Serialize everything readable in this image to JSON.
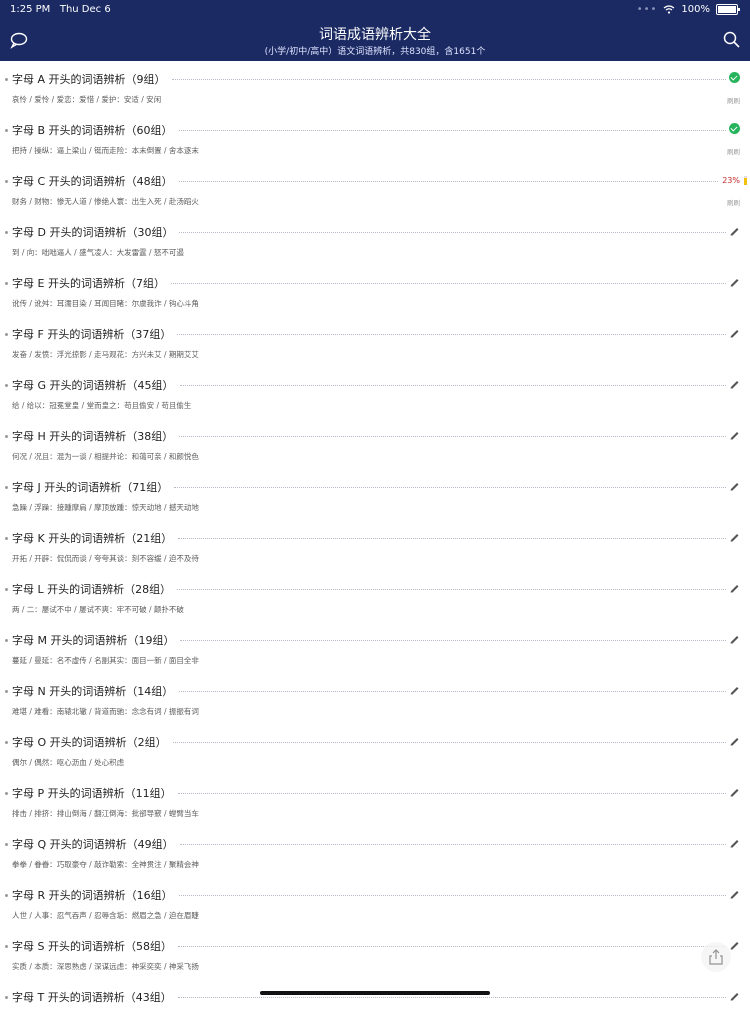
{
  "status": {
    "time": "1:25 PM",
    "date": "Thu Dec 6",
    "battery": "100%"
  },
  "header": {
    "title": "词语成语辨析大全",
    "subtitle": "(小学/初中/高中）语文词语辨析，共830组，含1651个"
  },
  "icons": {
    "chat": "chat-bubble-icon",
    "search": "search-icon",
    "share": "share-icon",
    "edit": "pencil-icon",
    "done": "checkmark-circle-icon"
  },
  "colors": {
    "header_bg": "#1b2a63",
    "done_green": "#25b35b",
    "percent_red": "#c62828",
    "progress_yellow": "#f4c20d"
  },
  "groups": [
    {
      "heading": "字母 A 开头的词语辨析（9组）",
      "sub": "哀怜 / 爱怜 / 爱恋：爱惜 / 爱护：安适 / 安闲",
      "state": "done",
      "tag": "刷刷"
    },
    {
      "heading": "字母 B 开头的词语辨析（60组）",
      "sub": "把持 / 操纵：逼上梁山 / 铤而走险：本末倒置 / 舍本逐末",
      "state": "done",
      "tag": "刷刷"
    },
    {
      "heading": "字母 C 开头的词语辨析（48组）",
      "sub": "财务 / 财物：惨无人道 / 惨绝人寰：出生入死 / 赴汤蹈火",
      "state": "progress",
      "percent": "23%",
      "progress": 0.23,
      "tag": "刷刷"
    },
    {
      "heading": "字母 D 开头的词语辨析（30组）",
      "sub": "到 / 向：咄咄逼人 / 盛气凌人：大发雷霆 / 怒不可遏",
      "state": "edit"
    },
    {
      "heading": "字母 E 开头的词语辨析（7组）",
      "sub": "讹传 / 讹舛：耳濡目染 / 耳闻目睹：尔虞我诈 / 钩心斗角",
      "state": "edit"
    },
    {
      "heading": "字母 F 开头的词语辨析（37组）",
      "sub": "发奋 / 发愤：浮光掠影 / 走马观花：方兴未艾 / 期期艾艾",
      "state": "edit"
    },
    {
      "heading": "字母 G 开头的词语辨析（45组）",
      "sub": "给 / 给以：冠冕堂皇 / 堂而皇之：苟且偷安 / 苟且偷生",
      "state": "edit"
    },
    {
      "heading": "字母 H 开头的词语辨析（38组）",
      "sub": "何况 / 况且：混为一谈 / 相提并论：和蔼可亲 / 和颜悦色",
      "state": "edit"
    },
    {
      "heading": "字母 J 开头的词语辨析（71组）",
      "sub": "急躁 / 浮躁：接踵摩肩 / 摩顶放踵：惊天动地 / 撼天动地",
      "state": "edit"
    },
    {
      "heading": "字母 K 开头的词语辨析（21组）",
      "sub": "开拓 / 开辟：侃侃而谈 / 夸夸其谈：刻不容缓 / 迫不及待",
      "state": "edit"
    },
    {
      "heading": "字母 L 开头的词语辨析（28组）",
      "sub": "两 / 二：屡试不中 / 屡试不爽：牢不可破 / 颠扑不破",
      "state": "edit"
    },
    {
      "heading": "字母 M 开头的词语辨析（19组）",
      "sub": "蔓延 / 曼延：名不虚传 / 名副其实：面目一新 / 面目全非",
      "state": "edit"
    },
    {
      "heading": "字母 N 开头的词语辨析（14组）",
      "sub": "难堪 / 难看：南辕北辙 / 背道而驰：念念有词 / 振振有词",
      "state": "edit"
    },
    {
      "heading": "字母 O 开头的词语辨析（2组）",
      "sub": "偶尔 / 偶然：呕心沥血 / 处心积虑",
      "state": "edit"
    },
    {
      "heading": "字母 P 开头的词语辨析（11组）",
      "sub": "排击 / 排挤：排山倒海 / 翻江倒海：批郤导窾 / 螳臂当车",
      "state": "edit"
    },
    {
      "heading": "字母 Q 开头的词语辨析（49组）",
      "sub": "拳拳 / 眷眷：巧取豪夺 / 敲诈勒索：全神贯注 / 聚精会神",
      "state": "edit"
    },
    {
      "heading": "字母 R 开头的词语辨析（16组）",
      "sub": "人世 / 人事：忍气吞声 / 忍辱含垢：燃眉之急 / 迫在眉睫",
      "state": "edit"
    },
    {
      "heading": "字母 S 开头的词语辨析（58组）",
      "sub": "实质 / 本质：深思熟虑 / 深谋远虑：神采奕奕 / 神采飞扬",
      "state": "edit"
    },
    {
      "heading": "字母 T 开头的词语辨析（43组）",
      "sub": "",
      "state": "edit"
    }
  ]
}
